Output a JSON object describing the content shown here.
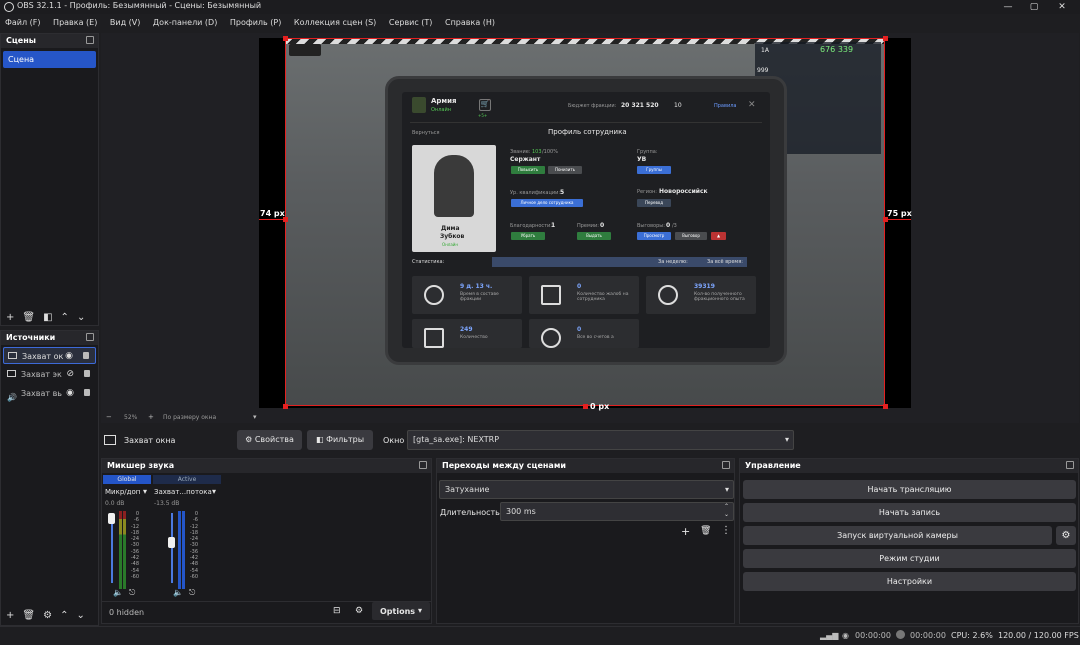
{
  "window": {
    "title": "OBS 32.1.1 - Профиль: Безымянный - Сцены: Безымянный",
    "buttons": [
      "—",
      "▢",
      "✕"
    ]
  },
  "menu": [
    "Файл (F)",
    "Правка (E)",
    "Вид (V)",
    "Док-панели (D)",
    "Профиль (P)",
    "Коллекция сцен (S)",
    "Сервис (T)",
    "Справка (H)"
  ],
  "scenes": {
    "title": "Сцены",
    "items": [
      "Сцена"
    ]
  },
  "sources": {
    "title": "Источники",
    "items": [
      "Захват ок",
      "Захват эк",
      "Захват вь"
    ]
  },
  "preview": {
    "zoom": "52%",
    "fit": "По размеру окна",
    "left_px": "74 px",
    "right_px": "75 px",
    "bottom_px": "0 px"
  },
  "game": {
    "faction": "Армия",
    "online": "Онлайн",
    "cart_badge": "+5+",
    "budget_label": "Бюджет фракции:",
    "budget": "20 321 520",
    "budget_count": "10",
    "rules": "Правила",
    "back": "Вернуться",
    "profile_title": "Профиль сотрудника",
    "first_name": "Дима",
    "last_name": "Зубков",
    "status": "Онлайн",
    "rank_label": "Звание:",
    "rank_progress": "103",
    "rank_progress_max": "/100%",
    "rank": "Сержант",
    "promote": "Повысить",
    "demote": "Понизить",
    "group_label": "Группа:",
    "group": "УВ",
    "groups_btn": "Группы",
    "qual_label": "Ур. квалификации:",
    "qual": "5",
    "personal_btn": "Личное дело сотрудника",
    "region_label": "Регион:",
    "region": "Новороссийск",
    "transfer": "Перевод",
    "thanks_label": "Благодарности:",
    "thanks": "1",
    "add1": "Убрать",
    "bonus_label": "Премии:",
    "bonus": "0",
    "issue": "Выдать",
    "rebuke_label": "Выговоры:",
    "rebuke": "0",
    "rebuke_max": "/3",
    "view": "Просмотр",
    "remove": "Выговор",
    "stats_label": "Статистика:",
    "week": "За неделю:",
    "all_time": "За всё время:",
    "stats": [
      {
        "value": "9 д. 13 ч.",
        "label": "Время в составе фракции"
      },
      {
        "value": "0",
        "label": "Количество жалоб на сотрудника"
      },
      {
        "value": "39319",
        "label": "Кол-во полученного фракционного опыта"
      },
      {
        "value": "249",
        "label": "Количество"
      },
      {
        "value": "0",
        "label": "Все во счетов а"
      }
    ],
    "hud_money": "676 339",
    "hud_a": "1А",
    "hud_999": "999"
  },
  "context": {
    "source_name": "Захват окна",
    "props": "Свойства",
    "filters": "Фильтры",
    "window_label": "Окно",
    "window_value": "[gta_sa.exe]: NEXTRP"
  },
  "mixer": {
    "title": "Микшер звука",
    "tab_global": "Global",
    "tab_active": "Active",
    "ch1": "Микр/доп",
    "ch1_db": "0.0 dB",
    "ch2": "Захват...потока",
    "ch2_db": "-13.5 dB",
    "scale": [
      "0",
      "-6",
      "-12",
      "-18",
      "-24",
      "-30",
      "-36",
      "-42",
      "-48",
      "-54",
      "-60"
    ],
    "hidden": "0 hidden",
    "options": "Options"
  },
  "transitions": {
    "title": "Переходы между сценами",
    "type": "Затухание",
    "duration_label": "Длительность",
    "duration": "300 ms"
  },
  "controls": {
    "title": "Управление",
    "start_stream": "Начать трансляцию",
    "start_record": "Начать запись",
    "virtual_cam": "Запуск виртуальной камеры",
    "studio": "Режим студии",
    "settings": "Настройки"
  },
  "status": {
    "stream_time": "00:00:00",
    "rec_time": "00:00:00",
    "cpu": "CPU: 2.6%",
    "fps": "120.00 / 120.00 FPS"
  }
}
